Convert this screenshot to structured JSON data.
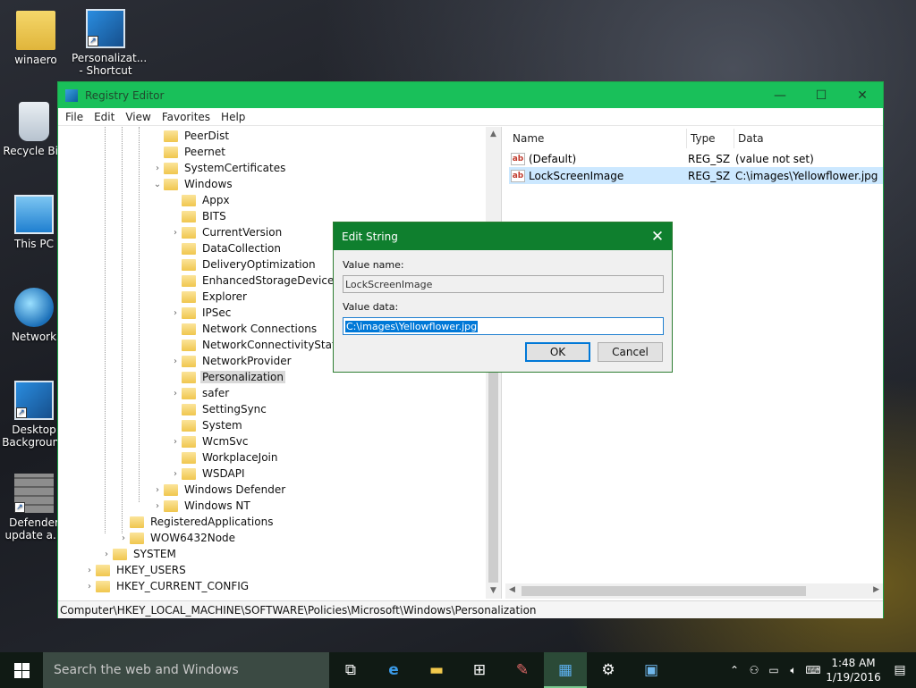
{
  "desktop": {
    "icons": [
      {
        "label": "winaero"
      },
      {
        "label": "Personalizat... - Shortcut"
      },
      {
        "label": "Recycle Bin"
      },
      {
        "label": "This PC"
      },
      {
        "label": "Network"
      },
      {
        "label": "Desktop Background"
      },
      {
        "label": "Defender update a..."
      }
    ]
  },
  "window": {
    "title": "Registry Editor",
    "controls": {
      "minimize": "—",
      "maximize": "☐",
      "close": "✕"
    },
    "menu": [
      "File",
      "Edit",
      "View",
      "Favorites",
      "Help"
    ],
    "tree": [
      {
        "label": "PeerDist",
        "expander": ""
      },
      {
        "label": "Peernet",
        "expander": ""
      },
      {
        "label": "SystemCertificates",
        "expander": "›"
      },
      {
        "label": "Windows",
        "expander": "⌄"
      },
      {
        "label": "Appx",
        "expander": ""
      },
      {
        "label": "BITS",
        "expander": ""
      },
      {
        "label": "CurrentVersion",
        "expander": "›"
      },
      {
        "label": "DataCollection",
        "expander": ""
      },
      {
        "label": "DeliveryOptimization",
        "expander": ""
      },
      {
        "label": "EnhancedStorageDevices",
        "expander": ""
      },
      {
        "label": "Explorer",
        "expander": ""
      },
      {
        "label": "IPSec",
        "expander": "›"
      },
      {
        "label": "Network Connections",
        "expander": ""
      },
      {
        "label": "NetworkConnectivityStatusIn",
        "expander": ""
      },
      {
        "label": "NetworkProvider",
        "expander": "›"
      },
      {
        "label": "Personalization",
        "expander": "",
        "selected": true
      },
      {
        "label": "safer",
        "expander": "›"
      },
      {
        "label": "SettingSync",
        "expander": ""
      },
      {
        "label": "System",
        "expander": ""
      },
      {
        "label": "WcmSvc",
        "expander": "›"
      },
      {
        "label": "WorkplaceJoin",
        "expander": ""
      },
      {
        "label": "WSDAPI",
        "expander": "›"
      },
      {
        "label": "Windows Defender",
        "expander": "›"
      },
      {
        "label": "Windows NT",
        "expander": "›"
      },
      {
        "label": "RegisteredApplications",
        "expander": ""
      },
      {
        "label": "WOW6432Node",
        "expander": "›"
      },
      {
        "label": "SYSTEM",
        "expander": "›"
      },
      {
        "label": "HKEY_USERS",
        "expander": "›"
      },
      {
        "label": "HKEY_CURRENT_CONFIG",
        "expander": "›"
      }
    ],
    "values": {
      "columns": [
        "Name",
        "Type",
        "Data"
      ],
      "rows": [
        {
          "name": "(Default)",
          "type": "REG_SZ",
          "data": "(value not set)",
          "icon": "ab"
        },
        {
          "name": "LockScreenImage",
          "type": "REG_SZ",
          "data": "C:\\images\\Yellowflower.jpg",
          "icon": "ab",
          "selected": true
        }
      ]
    },
    "status_path": "Computer\\HKEY_LOCAL_MACHINE\\SOFTWARE\\Policies\\Microsoft\\Windows\\Personalization"
  },
  "dialog": {
    "title": "Edit String",
    "close": "✕",
    "value_name_label": "Value name:",
    "value_name": "LockScreenImage",
    "value_data_label": "Value data:",
    "value_data": "C:\\images\\Yellowflower.jpg",
    "ok": "OK",
    "cancel": "Cancel"
  },
  "taskbar": {
    "search_placeholder": "Search the web and Windows",
    "time": "1:48 AM",
    "date": "1/19/2016",
    "accent": "#19c05a"
  }
}
